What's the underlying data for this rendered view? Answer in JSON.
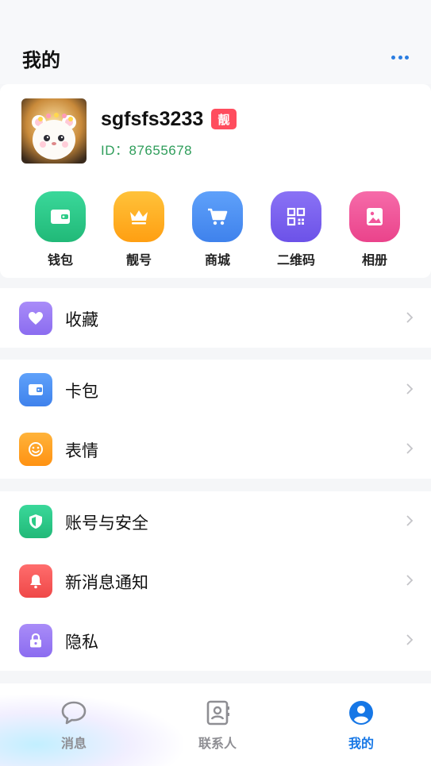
{
  "header": {
    "title": "我的"
  },
  "profile": {
    "username": "sgfsfs3233",
    "badge": "靓",
    "id_text": "ID：87655678"
  },
  "quick_actions": [
    {
      "label": "钱包",
      "icon": "wallet-icon",
      "color": "#2ccb87"
    },
    {
      "label": "靓号",
      "icon": "crown-icon",
      "color": "#ffb01f"
    },
    {
      "label": "商城",
      "icon": "cart-icon",
      "color": "#4a8ff0"
    },
    {
      "label": "二维码",
      "icon": "qrcode-icon",
      "color": "#7b62f0"
    },
    {
      "label": "相册",
      "icon": "album-icon",
      "color": "#f2579c"
    }
  ],
  "menu_groups": [
    [
      {
        "label": "收藏",
        "icon": "heart-icon",
        "color": "#9b7bf5"
      }
    ],
    [
      {
        "label": "卡包",
        "icon": "card-wallet-icon",
        "color": "#4a8ff0"
      },
      {
        "label": "表情",
        "icon": "smile-icon",
        "color": "#ff9f1f"
      }
    ],
    [
      {
        "label": "账号与安全",
        "icon": "shield-icon",
        "color": "#2ccb87"
      },
      {
        "label": "新消息通知",
        "icon": "bell-icon",
        "color": "#f55b5b"
      },
      {
        "label": "隐私",
        "icon": "lock-icon",
        "color": "#9b7bf5"
      }
    ]
  ],
  "tabs": [
    {
      "label": "消息",
      "icon": "chat-icon",
      "active": false
    },
    {
      "label": "联系人",
      "icon": "contacts-icon",
      "active": false
    },
    {
      "label": "我的",
      "icon": "user-icon",
      "active": true
    }
  ]
}
